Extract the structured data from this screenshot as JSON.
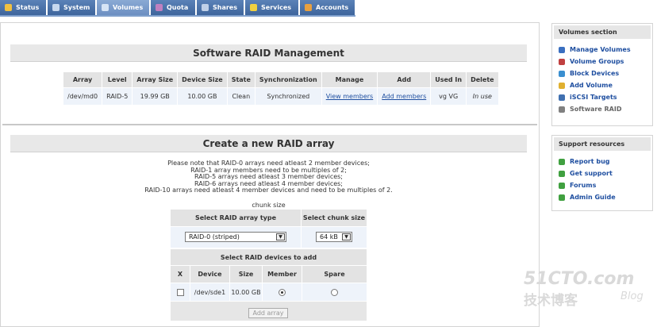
{
  "tabs": [
    {
      "label": "Status",
      "icon": "status-icon",
      "color": "#f0c040"
    },
    {
      "label": "System",
      "icon": "system-icon",
      "color": "#c8d8ee"
    },
    {
      "label": "Volumes",
      "icon": "volumes-icon",
      "color": "#d6e4f5"
    },
    {
      "label": "Quota",
      "icon": "quota-icon",
      "color": "#c080c0"
    },
    {
      "label": "Shares",
      "icon": "shares-icon",
      "color": "#c0d0e8"
    },
    {
      "label": "Services",
      "icon": "services-icon",
      "color": "#f0d040"
    },
    {
      "label": "Accounts",
      "icon": "accounts-icon",
      "color": "#e8a040"
    }
  ],
  "active_tab": "Volumes",
  "raid": {
    "title": "Software RAID Management",
    "headers": [
      "Array",
      "Level",
      "Array Size",
      "Device Size",
      "State",
      "Synchronization",
      "Manage",
      "Add",
      "Used In",
      "Delete"
    ],
    "rows": [
      {
        "array": "/dev/md0",
        "level": "RAID-5",
        "array_size": "19.99 GB",
        "device_size": "10.00 GB",
        "state": "Clean",
        "sync": "Synchronized",
        "manage": "View members",
        "add": "Add members",
        "used_in": "vg VG",
        "delete": "In use"
      }
    ]
  },
  "create": {
    "title": "Create a new RAID array",
    "notes": [
      "Please note that RAID-0 arrays need atleast 2 member devices;",
      "RAID-1 array members need to be multiples of 2;",
      "RAID-5 arrays need atleast 3 member devices;",
      "RAID-6 arrays need atleast 4 member devices;",
      "RAID-10 arrays need atleast 4 member devices and need to be multiples of 2."
    ],
    "chunk_caption": "chunk size",
    "type_header": "Select RAID array type",
    "chunk_header": "Select chunk size",
    "type_value": "RAID-0 (striped)",
    "chunk_value": "64 kB",
    "devices_header": "Select RAID devices to add",
    "device_columns": [
      "X",
      "Device",
      "Size",
      "Member",
      "Spare"
    ],
    "devices": [
      {
        "device": "/dev/sde1",
        "size": "10.00 GB",
        "member": true,
        "spare": false
      }
    ],
    "add_button": "Add array"
  },
  "sidebar": {
    "volumes_title": "Volumes section",
    "volumes_items": [
      {
        "label": "Manage Volumes",
        "color": "#3a6fc0"
      },
      {
        "label": "Volume Groups",
        "color": "#c04040"
      },
      {
        "label": "Block Devices",
        "color": "#3a8fd0"
      },
      {
        "label": "Add Volume",
        "color": "#e0b030"
      },
      {
        "label": "iSCSI Targets",
        "color": "#4070b0"
      },
      {
        "label": "Software RAID",
        "color": "#808080"
      }
    ],
    "support_title": "Support resources",
    "support_items": [
      {
        "label": "Report bug",
        "color": "#40a040"
      },
      {
        "label": "Get support",
        "color": "#40a040"
      },
      {
        "label": "Forums",
        "color": "#40a040"
      },
      {
        "label": "Admin Guide",
        "color": "#40a040"
      }
    ]
  },
  "watermark": {
    "line1": "51CTO.com",
    "line2": "技术博客",
    "line3": "Blog"
  }
}
